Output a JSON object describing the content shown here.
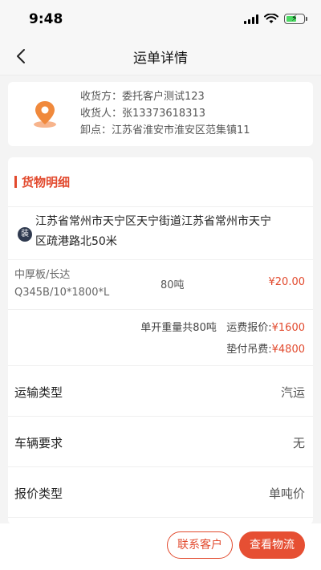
{
  "status_bar": {
    "time": "9:48"
  },
  "nav": {
    "title": "运单详情"
  },
  "address_card": {
    "shipper_label": "收货方：",
    "shipper_value": "委托客户测试123",
    "receiver_label": "收货人：",
    "receiver_value": "张13373618313",
    "unload_label": "卸点：",
    "unload_value": "江苏省淮安市淮安区范集镇11"
  },
  "goods": {
    "section_title": "货物明细",
    "badge": "装",
    "address_line1": "江苏省常州市天宁区天宁街道江苏省常州市天宁",
    "address_line2": "区疏港路北50米",
    "item_name_line1": "中厚板/长达",
    "item_name_line2": "Q345B/10*1800*L",
    "item_weight": "80吨",
    "item_price": "¥20.00",
    "summary_weight": "单开重量共80吨",
    "freight_label": "运费报价:",
    "freight_value": "¥1600",
    "advance_label": "垫付吊费:",
    "advance_value": "¥4800"
  },
  "info_rows": [
    {
      "label": "运输类型",
      "value": "汽运"
    },
    {
      "label": "车辆要求",
      "value": "无"
    },
    {
      "label": "报价类型",
      "value": "单吨价"
    }
  ],
  "buttons": {
    "contact": "联系客户",
    "logistics": "查看物流"
  },
  "colors": {
    "accent": "#e24a2e",
    "location_icon": "#f0893c"
  }
}
